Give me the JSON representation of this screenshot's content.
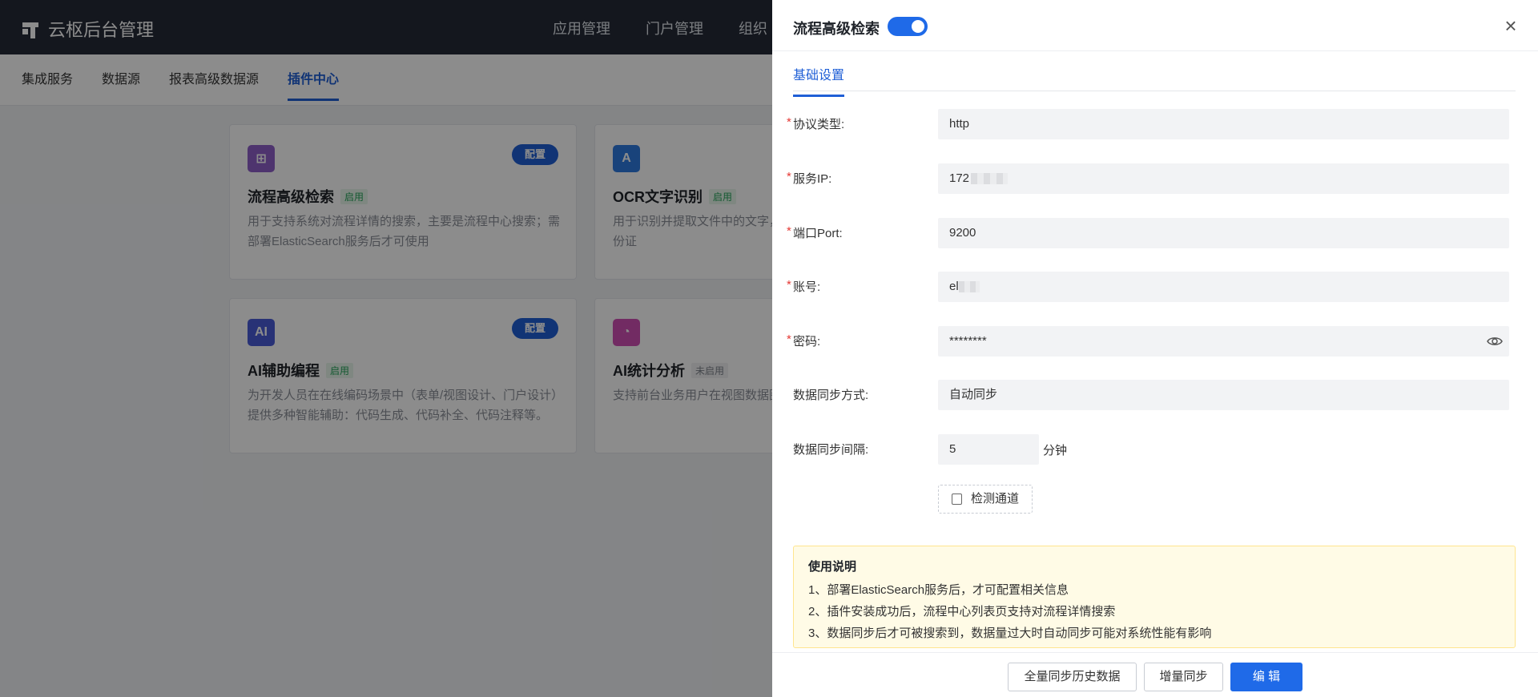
{
  "app": {
    "title": "云枢后台管理",
    "topnav": [
      "应用管理",
      "门户管理",
      "组织"
    ],
    "subtabs": [
      "集成服务",
      "数据源",
      "报表高级数据源",
      "插件中心"
    ]
  },
  "cards": [
    {
      "title": "流程高级检索",
      "status": "启用",
      "config": "配置",
      "desc": "用于支持系统对流程详情的搜索，主要是流程中心搜索；需部署ElasticSearch服务后才可使用",
      "icon": "flow-search-icon",
      "color": "#8e5fc9"
    },
    {
      "title": "OCR文字识别",
      "status": "启用",
      "desc": "用于识别并提取文件中的文字，指定字段中。例如:读取身份证",
      "icon": "ocr-icon",
      "color": "#2f7be0"
    },
    {
      "title": "AI辅助编程",
      "status": "启用",
      "config": "配置",
      "desc": "为开发人员在在线编码场景中（表单/视图设计、门户设计）提供多种智能辅助：代码生成、代码补全、代码注释等。",
      "icon": "ai-code-icon",
      "color": "#4a5bd8"
    },
    {
      "title": "AI统计分析",
      "status": "未启用",
      "desc": "支持前台业务用户在视图数据图表，完成数据洞察。",
      "icon": "ai-chart-icon",
      "color": "#d04fb4"
    }
  ],
  "drawer": {
    "title": "流程高级检索",
    "enabled": true,
    "tab": "基础设置",
    "fields": [
      {
        "label": "协议类型:",
        "value": "http",
        "required": true
      },
      {
        "label": "服务IP:",
        "value": "172",
        "required": true
      },
      {
        "label": "端口Port:",
        "value": "9200",
        "required": true
      },
      {
        "label": "账号:",
        "value": "el",
        "required": true
      },
      {
        "label": "密码:",
        "value": "********",
        "required": true
      },
      {
        "label": "数据同步方式:",
        "value": "自动同步",
        "required": false
      },
      {
        "label": "数据同步间隔:",
        "value": "5",
        "required": false,
        "unit": "分钟"
      }
    ],
    "detect_button": "检测通道",
    "notice": {
      "title": "使用说明",
      "lines": [
        "1、部署ElasticSearch服务后，才可配置相关信息",
        "2、插件安装成功后，流程中心列表页支持对流程详情搜索",
        "3、数据同步后才可被搜索到，数据量过大时自动同步可能对系统性能有影响"
      ]
    },
    "footer": {
      "full_sync": "全量同步历史数据",
      "incr_sync": "增量同步",
      "edit": "编 辑"
    },
    "accent": "#1f6ae8"
  }
}
